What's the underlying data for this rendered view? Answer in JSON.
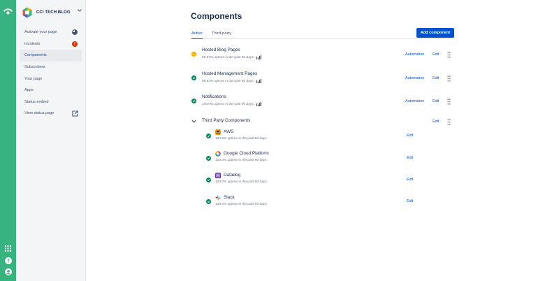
{
  "rail": {
    "logo_icon": "statuspage-icon",
    "bottom_icons": [
      "app-switcher-icon",
      "help-icon",
      "profile-icon"
    ]
  },
  "sidebar": {
    "brand": {
      "name": "CCI TECH BLOG",
      "chevron": "⌄"
    },
    "items": [
      {
        "label": "Activate your page",
        "extra": "progress-icon"
      },
      {
        "label": "Incidents",
        "badge": "!"
      },
      {
        "label": "Components",
        "active": true
      },
      {
        "label": "Subscribers"
      },
      {
        "label": "Your page"
      },
      {
        "label": "Apps"
      },
      {
        "label": "Status embed"
      },
      {
        "label": "View status page",
        "extra": "external-link-icon"
      }
    ]
  },
  "main": {
    "title": "Components",
    "tabs": [
      {
        "label": "Active",
        "active": true
      },
      {
        "label": "Third-party",
        "active": false
      }
    ],
    "add_button": "Add component",
    "components": [
      {
        "name": "Hosted Blog Pages",
        "uptime": "99.97% uptime in the past 90 days.",
        "status": "degraded",
        "automation": "Automation",
        "edit": "Edit"
      },
      {
        "name": "Hosted Management Pages",
        "uptime": "99.93% uptime in the past 90 days.",
        "status": "operational",
        "automation": "Automation",
        "edit": "Edit"
      },
      {
        "name": "Notifications",
        "uptime": "100.0% uptime in the past 90 days.",
        "status": "operational",
        "automation": "Automation",
        "edit": "Edit"
      }
    ],
    "group": {
      "name": "Third Party Components",
      "edit": "Edit",
      "children": [
        {
          "name": "AWS",
          "uptime": "100.0% uptime in the past 90 days.",
          "logo": "aws-logo",
          "edit": "Edit"
        },
        {
          "name": "Google Cloud Platform",
          "uptime": "100.0% uptime in the past 90 days.",
          "logo": "google-cloud-logo",
          "edit": "Edit"
        },
        {
          "name": "Datadog",
          "uptime": "100.0% uptime in the past 90 days.",
          "logo": "datadog-logo",
          "edit": "Edit"
        },
        {
          "name": "Slack",
          "uptime": "100.0% uptime in the past 90 days.",
          "logo": "slack-logo",
          "edit": "Edit"
        }
      ]
    }
  },
  "colors": {
    "rail": "#36b37e",
    "primary": "#0052cc",
    "operational": "#00875a",
    "degraded": "#ffab00",
    "danger": "#de350b"
  }
}
